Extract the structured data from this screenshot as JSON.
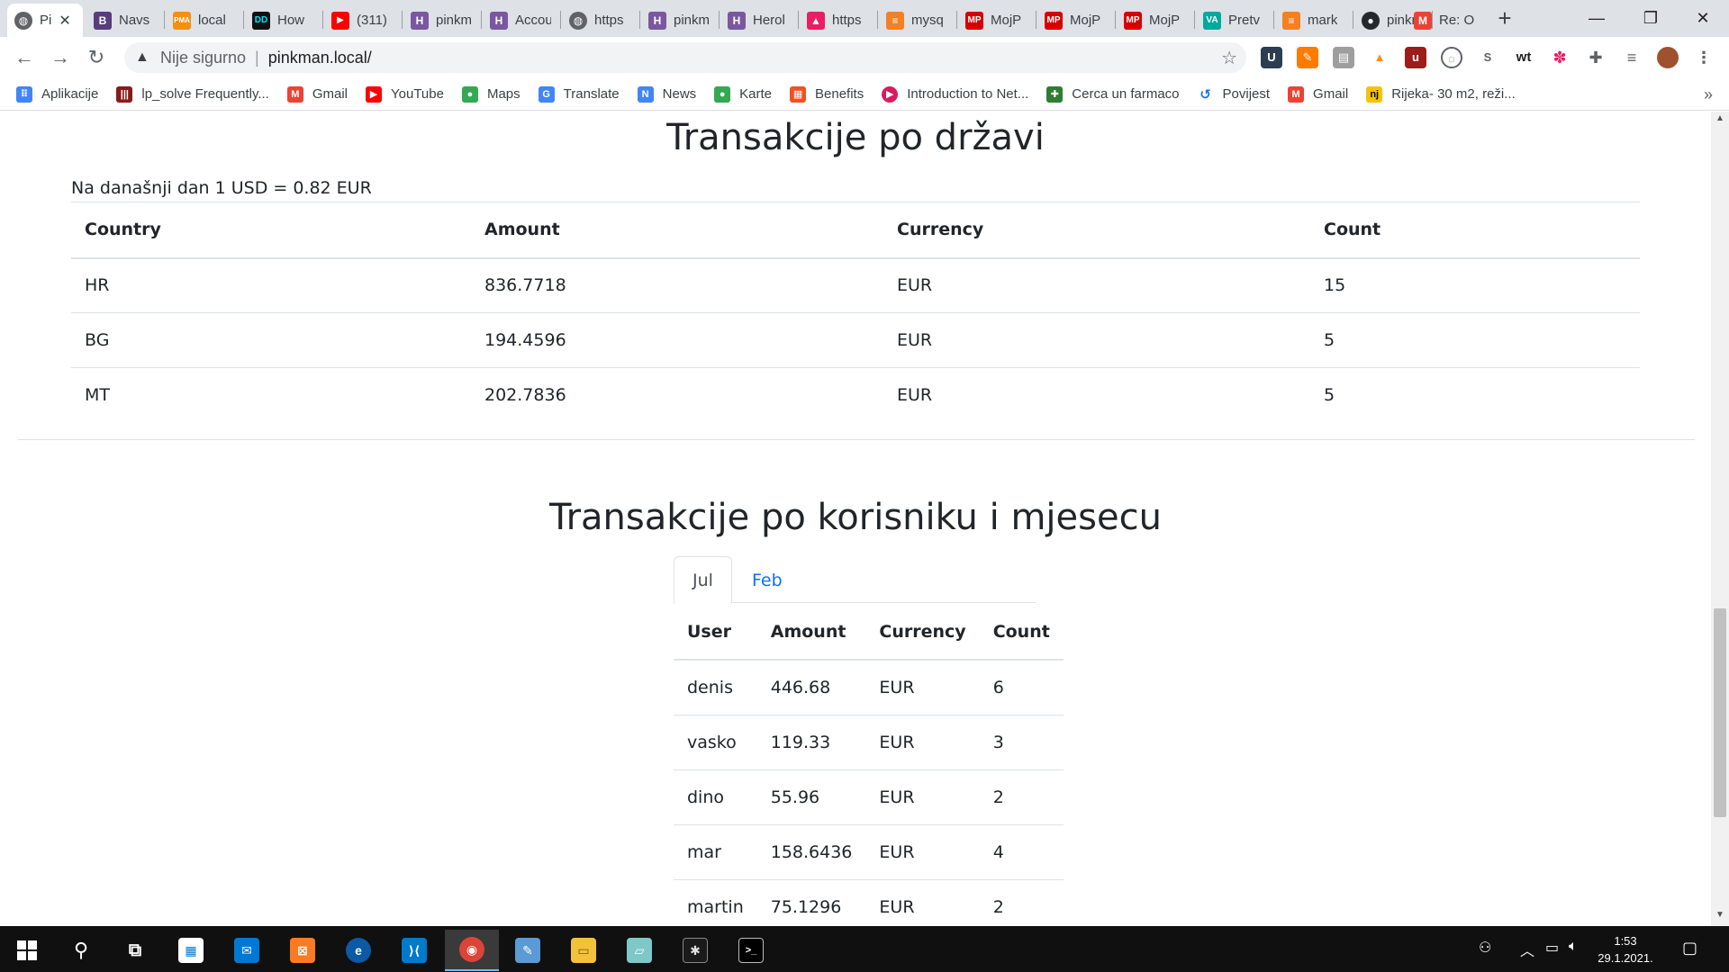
{
  "browser": {
    "tabs": [
      {
        "title": "Pi",
        "icon": "globe-icon",
        "color": "#5f6368"
      },
      {
        "title": "Navs",
        "icon": "bootstrap-icon",
        "color": "#563d7c"
      },
      {
        "title": "local",
        "icon": "phpmyadmin-icon",
        "color": "#f29111"
      },
      {
        "title": "How",
        "icon": "dd-icon",
        "color": "#111111"
      },
      {
        "title": "(311)",
        "icon": "youtube-icon",
        "color": "#ff0000"
      },
      {
        "title": "pinkm",
        "icon": "heroku-icon",
        "color": "#79589f"
      },
      {
        "title": "Accou",
        "icon": "heroku-icon",
        "color": "#79589f"
      },
      {
        "title": "https",
        "icon": "globe-icon",
        "color": "#5f6368"
      },
      {
        "title": "pinkm",
        "icon": "heroku-icon",
        "color": "#79589f"
      },
      {
        "title": "Herol",
        "icon": "heroku-icon",
        "color": "#79589f"
      },
      {
        "title": "https",
        "icon": "pink-triangle-icon",
        "color": "#e91e63"
      },
      {
        "title": "mysq",
        "icon": "stackoverflow-icon",
        "color": "#f48024"
      },
      {
        "title": "MojP",
        "icon": "mp-icon",
        "color": "#d50000"
      },
      {
        "title": "MojP",
        "icon": "mp-icon",
        "color": "#d50000"
      },
      {
        "title": "MojP",
        "icon": "mp-icon",
        "color": "#d50000"
      },
      {
        "title": "Pretv",
        "icon": "va-icon",
        "color": "#00a99d"
      },
      {
        "title": "mark",
        "icon": "stackoverflow-icon",
        "color": "#f48024"
      },
      {
        "title": "pinkn",
        "icon": "github-icon",
        "color": "#24292e"
      },
      {
        "title": "Re: O",
        "icon": "gmail-icon",
        "color": "#ea4335"
      }
    ],
    "security_label": "Nije sigurno",
    "url": "pinkman.local/",
    "bookmarks": [
      {
        "label": "Aplikacije",
        "icon": "apps-grid-icon",
        "color": "#4285f4"
      },
      {
        "label": "lp_solve Frequently...",
        "icon": "bars-icon",
        "color": "#8b1a1a"
      },
      {
        "label": "Gmail",
        "icon": "gmail-icon",
        "color": "#ea4335"
      },
      {
        "label": "YouTube",
        "icon": "youtube-icon",
        "color": "#ff0000"
      },
      {
        "label": "Maps",
        "icon": "maps-pin-icon",
        "color": "#34a853"
      },
      {
        "label": "Translate",
        "icon": "translate-icon",
        "color": "#4285f4"
      },
      {
        "label": "News",
        "icon": "news-icon",
        "color": "#4285f4"
      },
      {
        "label": "Karte",
        "icon": "maps-pin-icon",
        "color": "#34a853"
      },
      {
        "label": "Benefits",
        "icon": "microsoft-icon",
        "color": "#f25022"
      },
      {
        "label": "Introduction to Net...",
        "icon": "play-circle-icon",
        "color": "#d81b60"
      },
      {
        "label": "Cerca un farmaco",
        "icon": "pharmacy-icon",
        "color": "#2e7d32"
      },
      {
        "label": "Povijest",
        "icon": "history-icon",
        "color": "#1a73e8"
      },
      {
        "label": "Gmail",
        "icon": "gmail-icon",
        "color": "#ea4335"
      },
      {
        "label": "Rijeka- 30 m2, reži...",
        "icon": "nj-icon",
        "color": "#f5c400"
      }
    ]
  },
  "page": {
    "country_section": {
      "title": "Transakcije po državi",
      "rate_note": "Na današnji dan 1 USD = 0.82 EUR",
      "columns": [
        "Country",
        "Amount",
        "Currency",
        "Count"
      ],
      "rows": [
        [
          "HR",
          "836.7718",
          "EUR",
          "15"
        ],
        [
          "BG",
          "194.4596",
          "EUR",
          "5"
        ],
        [
          "MT",
          "202.7836",
          "EUR",
          "5"
        ]
      ]
    },
    "user_section": {
      "title": "Transakcije po korisniku i mjesecu",
      "tabs": [
        {
          "label": "Jul",
          "active": true
        },
        {
          "label": "Feb",
          "active": false
        }
      ],
      "columns": [
        "User",
        "Amount",
        "Currency",
        "Count"
      ],
      "rows": [
        [
          "denis",
          "446.68",
          "EUR",
          "6"
        ],
        [
          "vasko",
          "119.33",
          "EUR",
          "3"
        ],
        [
          "dino",
          "55.96",
          "EUR",
          "2"
        ],
        [
          "mar",
          "158.6436",
          "EUR",
          "4"
        ],
        [
          "martin",
          "75.1296",
          "EUR",
          "2"
        ]
      ]
    }
  },
  "taskbar": {
    "clock_time": "1:53",
    "clock_date": "29.1.2021."
  }
}
